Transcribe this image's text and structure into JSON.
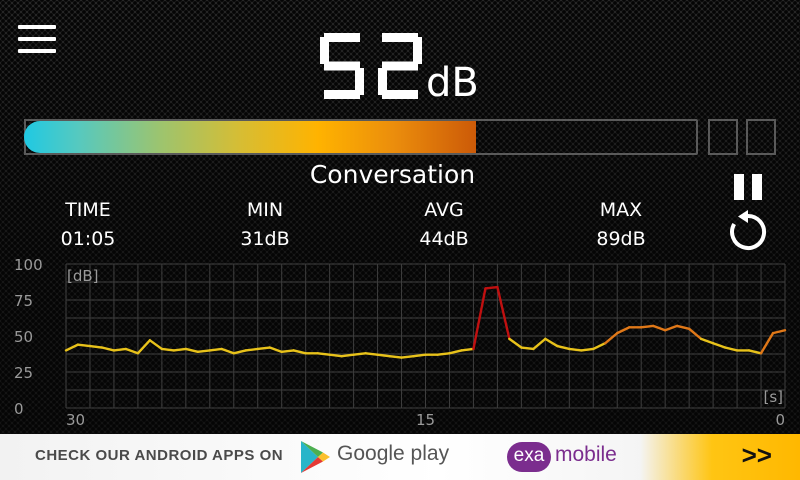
{
  "header": {
    "menu_icon": "hamburger-menu-icon",
    "db_value": "52",
    "db_unit": "dB"
  },
  "level": {
    "fill_fraction": 0.67,
    "label": "Conversation"
  },
  "stats": [
    {
      "label": "TIME",
      "value": "01:05"
    },
    {
      "label": "MIN",
      "value": "31dB"
    },
    {
      "label": "AVG",
      "value": "44dB"
    },
    {
      "label": "MAX",
      "value": "89dB"
    }
  ],
  "controls": {
    "pause_icon": "pause-icon",
    "reset_icon": "restart-icon"
  },
  "chart_data": {
    "type": "line",
    "y_unit_label": "[dB]",
    "x_unit_label": "[s]",
    "ylim": [
      0,
      100
    ],
    "xlim": [
      30,
      0
    ],
    "y_ticks": [
      "100",
      "75",
      "50",
      "25",
      "0"
    ],
    "x_ticks": [
      "30",
      "15",
      "0"
    ],
    "grid": true,
    "colors": {
      "low": "#e8c21a",
      "mid": "#e07818",
      "high": "#c01010"
    },
    "series": [
      {
        "x": [
          30,
          29.5,
          29,
          28.5,
          28,
          27.5,
          27,
          26.5,
          26,
          25.5,
          25,
          24.5,
          24,
          23.5,
          23,
          22.5,
          22,
          21.5,
          21,
          20.5,
          20,
          19.5,
          19,
          18.5,
          18,
          17.5,
          17,
          16.5,
          16,
          15.5,
          15,
          14.5,
          14,
          13.5,
          13,
          12.5,
          12,
          11.5,
          11,
          10.5,
          10,
          9.5,
          9,
          8.5,
          8,
          7.5,
          7,
          6.5,
          6,
          5.5,
          5,
          4.5,
          4,
          3.5,
          3,
          2.5,
          2,
          1.5,
          1,
          0.5,
          0
        ],
        "values": [
          40,
          44,
          43,
          42,
          40,
          41,
          38,
          47,
          41,
          40,
          41,
          39,
          40,
          41,
          38,
          40,
          41,
          42,
          39,
          40,
          38,
          38,
          37,
          36,
          37,
          38,
          37,
          36,
          35,
          36,
          37,
          37,
          38,
          40,
          41,
          83,
          84,
          48,
          42,
          41,
          48,
          43,
          41,
          40,
          41,
          45,
          52,
          56,
          56,
          57,
          54,
          57,
          55,
          48,
          45,
          42,
          40,
          40,
          38,
          52,
          54
        ]
      }
    ]
  },
  "ad": {
    "text": "CHECK OUR ANDROID APPS ON",
    "store_icon": "google-play-icon",
    "store_text": "Google play",
    "brand_badge": "exa",
    "brand_text": "mobile",
    "arrow": ">>"
  }
}
